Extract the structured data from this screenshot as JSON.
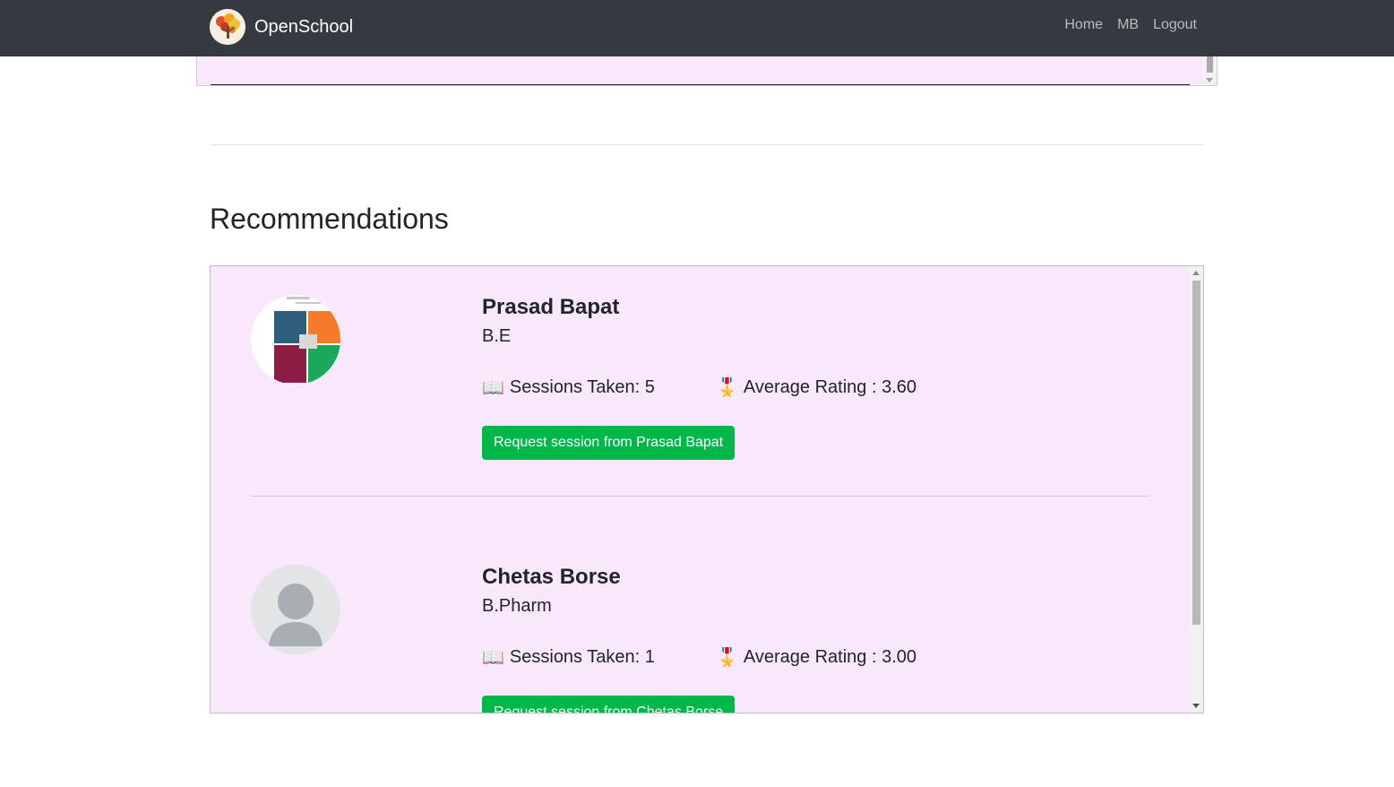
{
  "navbar": {
    "brand": "OpenSchool",
    "links": [
      "Home",
      "MB",
      "Logout"
    ]
  },
  "section_title": "Recommendations",
  "mentors": [
    {
      "name": "Prasad Bapat",
      "degree": "B.E",
      "sessions_label": "Sessions Taken: 5",
      "rating_label": "Average Rating : 3.60",
      "button_label": "Request session from Prasad Bapat",
      "avatar": "photo"
    },
    {
      "name": "Chetas Borse",
      "degree": "B.Pharm",
      "sessions_label": "Sessions Taken: 1",
      "rating_label": "Average Rating : 3.00",
      "button_label": "Request session from Chetas Borse",
      "avatar": "default-user-icon"
    }
  ],
  "icons": {
    "sessions": "📖",
    "rating": "🎖️"
  },
  "colors": {
    "navbar": "#343a40",
    "panel": "#f9e8fb",
    "button": "#00b84a"
  }
}
